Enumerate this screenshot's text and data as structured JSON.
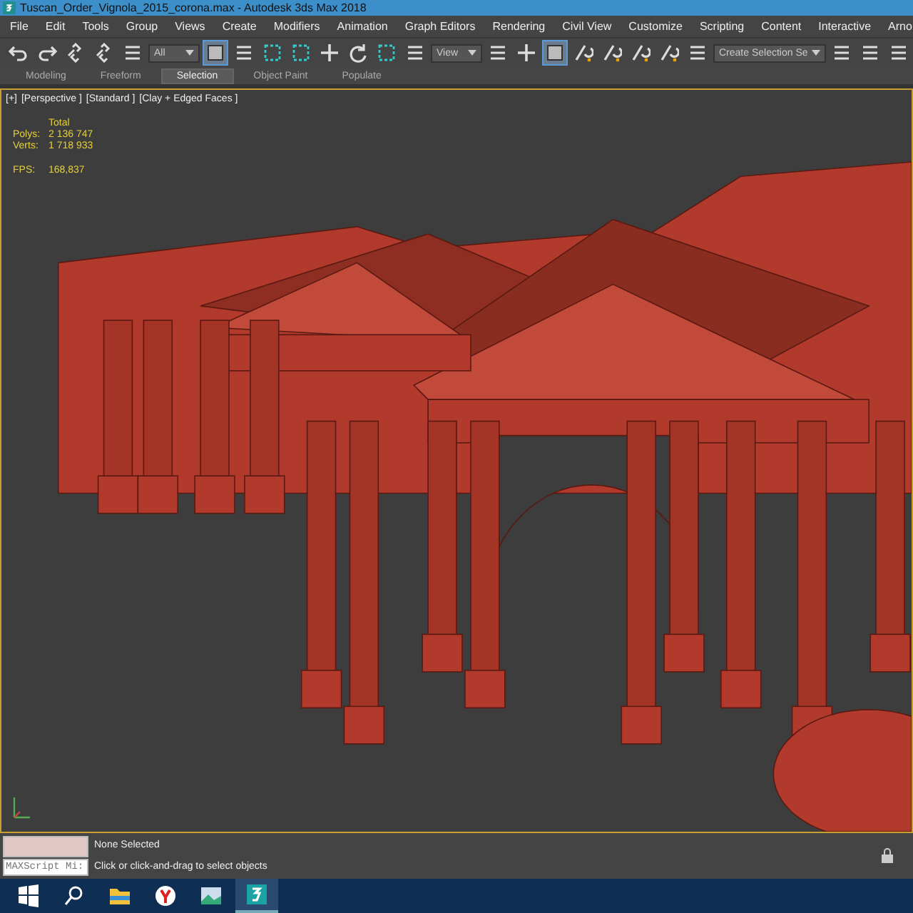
{
  "window": {
    "title": "Tuscan_Order_Vignola_2015_corona.max - Autodesk 3ds Max 2018"
  },
  "menu": [
    "File",
    "Edit",
    "Tools",
    "Group",
    "Views",
    "Create",
    "Modifiers",
    "Animation",
    "Graph Editors",
    "Rendering",
    "Civil View",
    "Customize",
    "Scripting",
    "Content",
    "Interactive",
    "Arno"
  ],
  "toolbar": [
    {
      "kind": "undo",
      "selected": false
    },
    {
      "kind": "redo",
      "selected": false
    },
    {
      "kind": "link",
      "selected": false
    },
    {
      "kind": "unlink",
      "selected": false
    },
    {
      "kind": "bind",
      "selected": false
    },
    {
      "kind": "dropdown",
      "value": "All"
    },
    {
      "kind": "select",
      "selected": true
    },
    {
      "kind": "list",
      "selected": false
    },
    {
      "kind": "rect",
      "selected": false
    },
    {
      "kind": "window",
      "selected": false
    },
    {
      "kind": "move",
      "selected": false
    },
    {
      "kind": "rotate",
      "selected": false
    },
    {
      "kind": "scale",
      "selected": false
    },
    {
      "kind": "place",
      "selected": false
    },
    {
      "kind": "dropdown",
      "value": "View"
    },
    {
      "kind": "pivot",
      "selected": false
    },
    {
      "kind": "cross",
      "selected": false
    },
    {
      "kind": "manip",
      "selected": true
    },
    {
      "kind": "snap",
      "selected": false
    },
    {
      "kind": "angle",
      "selected": false
    },
    {
      "kind": "percent",
      "selected": false
    },
    {
      "kind": "spinner",
      "selected": false
    },
    {
      "kind": "braces",
      "selected": false
    },
    {
      "kind": "dropdown",
      "value": "Create Selection Se"
    },
    {
      "kind": "mirror",
      "selected": false
    },
    {
      "kind": "align",
      "selected": false
    },
    {
      "kind": "layers",
      "selected": false
    }
  ],
  "ribbon_tabs": [
    {
      "label": "Modeling",
      "selected": false
    },
    {
      "label": "Freeform",
      "selected": false
    },
    {
      "label": "Selection",
      "selected": true
    },
    {
      "label": "Object Paint",
      "selected": false
    },
    {
      "label": "Populate",
      "selected": false
    }
  ],
  "viewport": {
    "labels": [
      "[+]",
      "[Perspective ]",
      "[Standard ]",
      "[Clay + Edged Faces ]"
    ],
    "stats": {
      "header": "Total",
      "rows": [
        {
          "label": "Polys:",
          "value": "2 136 747"
        },
        {
          "label": "Verts:",
          "value": "1 718 933"
        }
      ],
      "fps_label": "FPS:",
      "fps_value": "168,837"
    }
  },
  "status": {
    "script_value": "MAXScript Mi:",
    "selection": "None Selected",
    "prompt": "Click or click-and-drag to select objects"
  },
  "taskbar": [
    {
      "kind": "start",
      "selected": false
    },
    {
      "kind": "search",
      "selected": false
    },
    {
      "kind": "folder",
      "selected": false
    },
    {
      "kind": "browser",
      "selected": false
    },
    {
      "kind": "photos",
      "selected": false
    },
    {
      "kind": "max",
      "selected": true
    }
  ]
}
